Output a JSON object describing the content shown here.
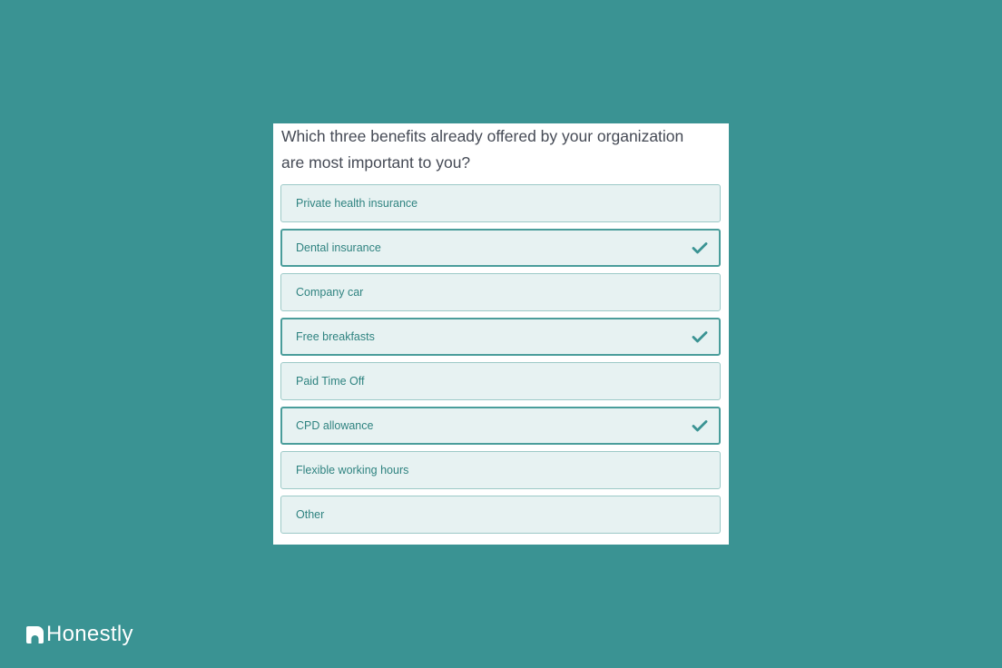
{
  "question": {
    "line1": "Which three benefits already offered by your organization",
    "line2": "are most important to you?"
  },
  "options": [
    {
      "label": "Private health insurance",
      "selected": false
    },
    {
      "label": "Dental insurance",
      "selected": true
    },
    {
      "label": "Company car",
      "selected": false
    },
    {
      "label": "Free breakfasts",
      "selected": true
    },
    {
      "label": "Paid Time Off",
      "selected": false
    },
    {
      "label": "CPD allowance",
      "selected": true
    },
    {
      "label": "Flexible working hours",
      "selected": false
    },
    {
      "label": "Other",
      "selected": false
    }
  ],
  "icons": {
    "selected_option": "checkmark-icon",
    "brand": "honestly-logo-icon"
  },
  "brand": {
    "name": "Honestly"
  },
  "colors": {
    "background": "#3a9393",
    "option_fill": "#e7f2f2",
    "option_text": "#2f8380",
    "selected_border": "#4a9d9b",
    "question_text": "#454a55"
  }
}
